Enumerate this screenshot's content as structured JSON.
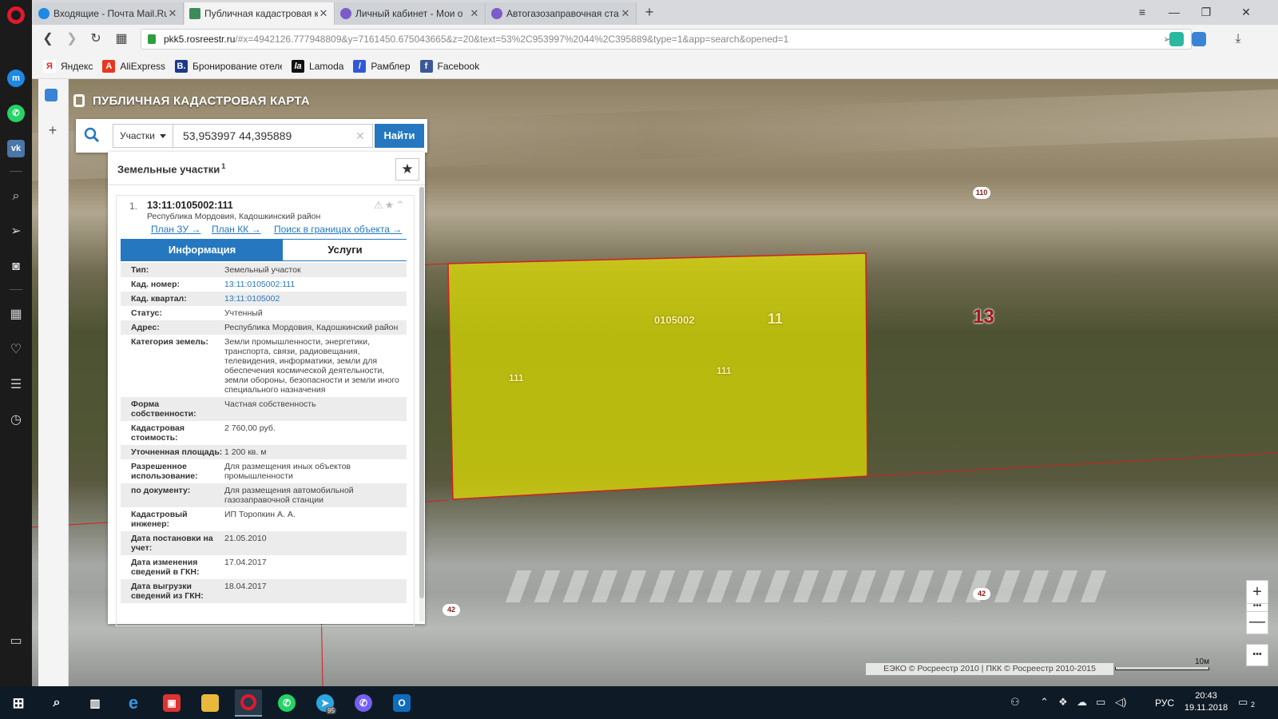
{
  "browser": {
    "tabs": [
      {
        "title": "Входящие - Почта Mail.Ru",
        "favicon_color": "#1e88e5"
      },
      {
        "title": "Публичная кадастровая к",
        "favicon_color": "#3d8b5a"
      },
      {
        "title": "Личный кабинет - Мои о",
        "favicon_color": "#7c5cc8"
      },
      {
        "title": "Автогазозаправочная ста",
        "favicon_color": "#7c5cc8"
      }
    ],
    "url_domain": "pkk5.rosreestr.ru",
    "url_rest": "/#x=4942126.777948809&y=7161450.675043665&z=20&text=53%2C953997%2044%2C395889&type=1&app=search&opened=1",
    "bookmarks": [
      {
        "label": "Яндекс",
        "icon": "yandex-icon",
        "color": "#e52620",
        "glyph": "Я"
      },
      {
        "label": "AliExpress",
        "icon": "aliexpress-icon",
        "color": "#e8361f",
        "glyph": "A"
      },
      {
        "label": "Бронирование отеле",
        "icon": "booking-icon",
        "color": "#1b3a8a",
        "glyph": "B."
      },
      {
        "label": "Lamoda",
        "icon": "lamoda-icon",
        "color": "#111111",
        "glyph": "la"
      },
      {
        "label": "Рамблер",
        "icon": "rambler-icon",
        "color": "#3158d6",
        "glyph": "/"
      },
      {
        "label": "Facebook",
        "icon": "facebook-icon",
        "color": "#3b5998",
        "glyph": "f"
      }
    ]
  },
  "app": {
    "brand": "ПУБЛИЧНАЯ КАДАСТРОВАЯ КАРТА",
    "search": {
      "type_label": "Участки",
      "query": "53,953997 44,395889",
      "button": "Найти"
    },
    "results": {
      "title": "Земельные участки",
      "count": "1",
      "item": {
        "index": "1.",
        "cad_number": "13:11:0105002:111",
        "location": "Республика Мордовия, Кадошкинский район",
        "links": [
          "План ЗУ →",
          "План КК →",
          "Поиск в границах объекта →"
        ],
        "tab_info": "Информация",
        "tab_services": "Услуги",
        "attributes": [
          {
            "k": "Тип:",
            "v": "Земельный участок"
          },
          {
            "k": "Кад. номер:",
            "v": "13:11:0105002:111",
            "link": true
          },
          {
            "k": "Кад. квартал:",
            "v": "13:11:0105002",
            "link": true
          },
          {
            "k": "Статус:",
            "v": "Учтенный"
          },
          {
            "k": "Адрес:",
            "v": "Республика Мордовия, Кадошкинский район"
          },
          {
            "k": "Категория земель:",
            "v": "Земли промышленности, энергетики, транспорта, связи, радиовещания, телевидения, информатики, земли для обеспечения космической деятельности, земли обороны, безопасности и земли иного специального назначения"
          },
          {
            "k": "Форма собственности:",
            "v": "Частная собственность"
          },
          {
            "k": "Кадастровая стоимость:",
            "v": "2 760,00 руб."
          },
          {
            "k": "Уточненная площадь:",
            "v": "1 200 кв. м"
          },
          {
            "k": "Разрешенное использование:",
            "v": "Для размещения иных объектов промышленности"
          },
          {
            "k": "по документу:",
            "v": "Для размещения автомобильной газозаправочной станции"
          },
          {
            "k": "Кадастровый инженер:",
            "v": "ИП Торопкин А. А."
          },
          {
            "k": "Дата постановки на учет:",
            "v": "21.05.2010"
          },
          {
            "k": "Дата изменения сведений в ГКН:",
            "v": "17.04.2017"
          },
          {
            "k": "Дата выгрузки сведений из ГКН:",
            "v": "18.04.2017"
          }
        ]
      }
    },
    "map_labels": {
      "quarter": "0105002",
      "district": "11",
      "parcel_left": "111",
      "parcel_center": "111",
      "region": "13",
      "pill_110": "110",
      "pill_42_right": "42",
      "pill_42_left": "42",
      "pill_top": "110"
    },
    "attribution": "ЕЭКО © Росреестр 2010 | ПКК © Росреестр 2010-2015",
    "scale": "10м",
    "parcel_fill": "#e6e600",
    "boundary_color": "#d02020"
  },
  "taskbar": {
    "lang": "РУС",
    "time": "20:43",
    "date": "19.11.2018",
    "notifications": "2",
    "telegram_badge": "95"
  }
}
